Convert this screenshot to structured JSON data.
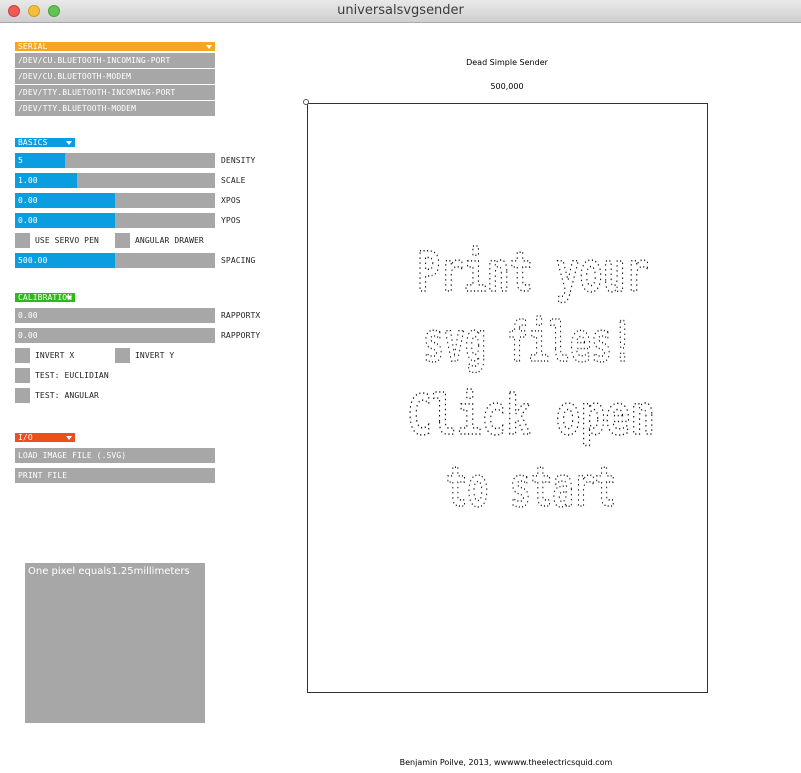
{
  "window": {
    "title": "universalsvgsender"
  },
  "serial": {
    "header": "SERIAL",
    "ports": [
      "/DEV/CU.BLUETOOTH-INCOMING-PORT",
      "/DEV/CU.BLUETOOTH-MODEM",
      "/DEV/TTY.BLUETOOTH-INCOMING-PORT",
      "/DEV/TTY.BLUETOOTH-MODEM"
    ]
  },
  "basics": {
    "header": "BASICS",
    "density": {
      "label": "DENSITY",
      "value": "5",
      "fraction": 0.25
    },
    "scale": {
      "label": "SCALE",
      "value": "1.00",
      "fraction": 0.31
    },
    "xpos": {
      "label": "XPOS",
      "value": "0.00",
      "fraction": 0.5
    },
    "ypos": {
      "label": "YPOS",
      "value": "0.00",
      "fraction": 0.5
    },
    "use_servo_pen": "USE SERVO PEN",
    "angular_drawer": "ANGULAR DRAWER",
    "spacing": {
      "label": "SPACING",
      "value": "500.00",
      "fraction": 0.5
    }
  },
  "calibration": {
    "header": "CALIBRATION",
    "rapportx": {
      "label": "RAPPORTX",
      "value": "0.00"
    },
    "rapporty": {
      "label": "RAPPORTY",
      "value": "0.00"
    },
    "invert_x": "INVERT X",
    "invert_y": "INVERT Y",
    "test_euclidian": "TEST: EUCLIDIAN",
    "test_angular": "TEST: ANGULAR"
  },
  "io": {
    "header": "I/O",
    "load": "LOAD IMAGE FILE (.SVG)",
    "print": "PRINT FILE"
  },
  "info": {
    "text": "One pixel equals1.25millimeters"
  },
  "canvas": {
    "title": "Dead Simple Sender",
    "value": "500,000",
    "placeholder_lines": [
      "Print your",
      "svg files!",
      "Click open",
      "to start"
    ]
  },
  "footer": "Benjamin Poilve, 2013, wwwww.theelectricsquid.com",
  "colors": {
    "serial": "#f5a623",
    "basics": "#0a9ee0",
    "calibration": "#2fb81e",
    "io": "#ee4d1c",
    "control_bg": "#a7a7a7"
  }
}
